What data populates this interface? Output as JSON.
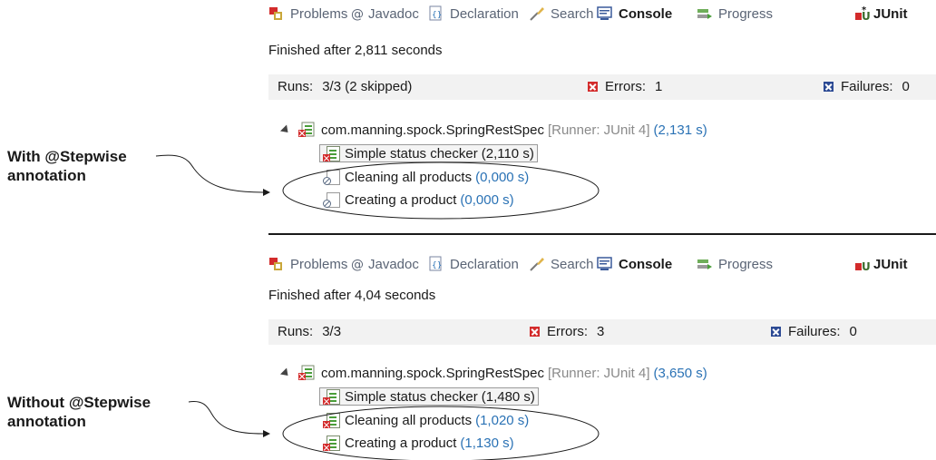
{
  "tabs": [
    {
      "label": "Problems",
      "icon": "problems-icon"
    },
    {
      "label": "Javadoc",
      "icon": "javadoc-icon"
    },
    {
      "label": "Declaration",
      "icon": "declaration-icon"
    },
    {
      "label": "Search",
      "icon": "search-icon"
    },
    {
      "label": "Console",
      "icon": "console-icon"
    },
    {
      "label": "Progress",
      "icon": "progress-icon"
    },
    {
      "label": "JUnit",
      "icon": "junit-icon"
    }
  ],
  "top": {
    "status": "Finished after 2,811 seconds",
    "runs_label": "Runs:",
    "runs_value": "3/3 (2 skipped)",
    "errors_label": "Errors:",
    "errors_value": "1",
    "failures_label": "Failures:",
    "failures_value": "0",
    "suite": {
      "name": "com.manning.spock.SpringRestSpec",
      "runner": "[Runner: JUnit 4]",
      "time": "(2,131 s)"
    },
    "tests": [
      {
        "name": "Simple status checker",
        "time": "(2,110 s)",
        "state": "error",
        "selected": true
      },
      {
        "name": "Cleaning all products",
        "time": "(0,000 s)",
        "state": "skipped"
      },
      {
        "name": "Creating a product",
        "time": "(0,000 s)",
        "state": "skipped"
      }
    ],
    "annotation": [
      "With @Stepwise",
      "annotation"
    ]
  },
  "bottom": {
    "status": "Finished after 4,04 seconds",
    "runs_label": "Runs:",
    "runs_value": "3/3",
    "errors_label": "Errors:",
    "errors_value": "3",
    "failures_label": "Failures:",
    "failures_value": "0",
    "suite": {
      "name": "com.manning.spock.SpringRestSpec",
      "runner": "[Runner: JUnit 4]",
      "time": "(3,650 s)"
    },
    "tests": [
      {
        "name": "Simple status checker",
        "time": "(1,480 s)",
        "state": "error",
        "selected": true
      },
      {
        "name": "Cleaning all products",
        "time": "(1,020 s)",
        "state": "error"
      },
      {
        "name": "Creating a product",
        "time": "(1,130 s)",
        "state": "error"
      }
    ],
    "annotation": [
      "Without @Stepwise",
      "annotation"
    ]
  },
  "colors": {
    "error": "#d32b2b",
    "failure": "#2c4a94",
    "time": "#2a72b5",
    "runner": "#8a8a8a",
    "tab_text": "#5a6475"
  }
}
